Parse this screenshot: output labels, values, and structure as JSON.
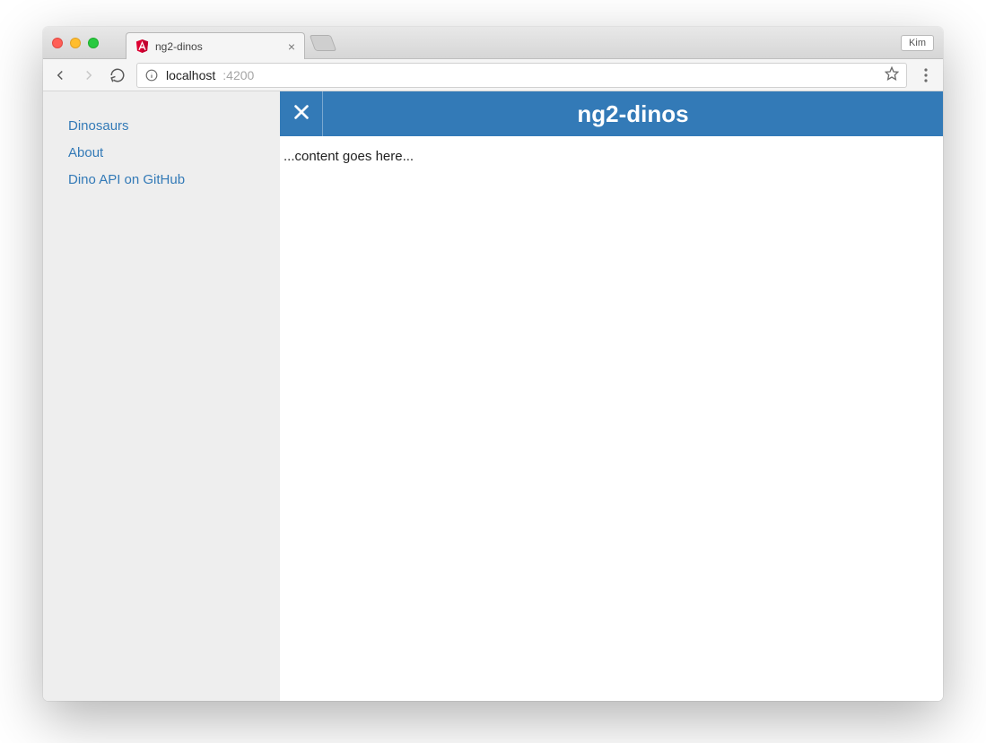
{
  "browser": {
    "tab": {
      "title": "ng2-dinos"
    },
    "user_badge": "Kim",
    "url": {
      "host": "localhost",
      "port": ":4200"
    }
  },
  "sidebar": {
    "items": [
      {
        "label": "Dinosaurs"
      },
      {
        "label": "About"
      },
      {
        "label": "Dino API on GitHub"
      }
    ]
  },
  "app": {
    "title": "ng2-dinos"
  },
  "main": {
    "placeholder": "...content goes here..."
  }
}
